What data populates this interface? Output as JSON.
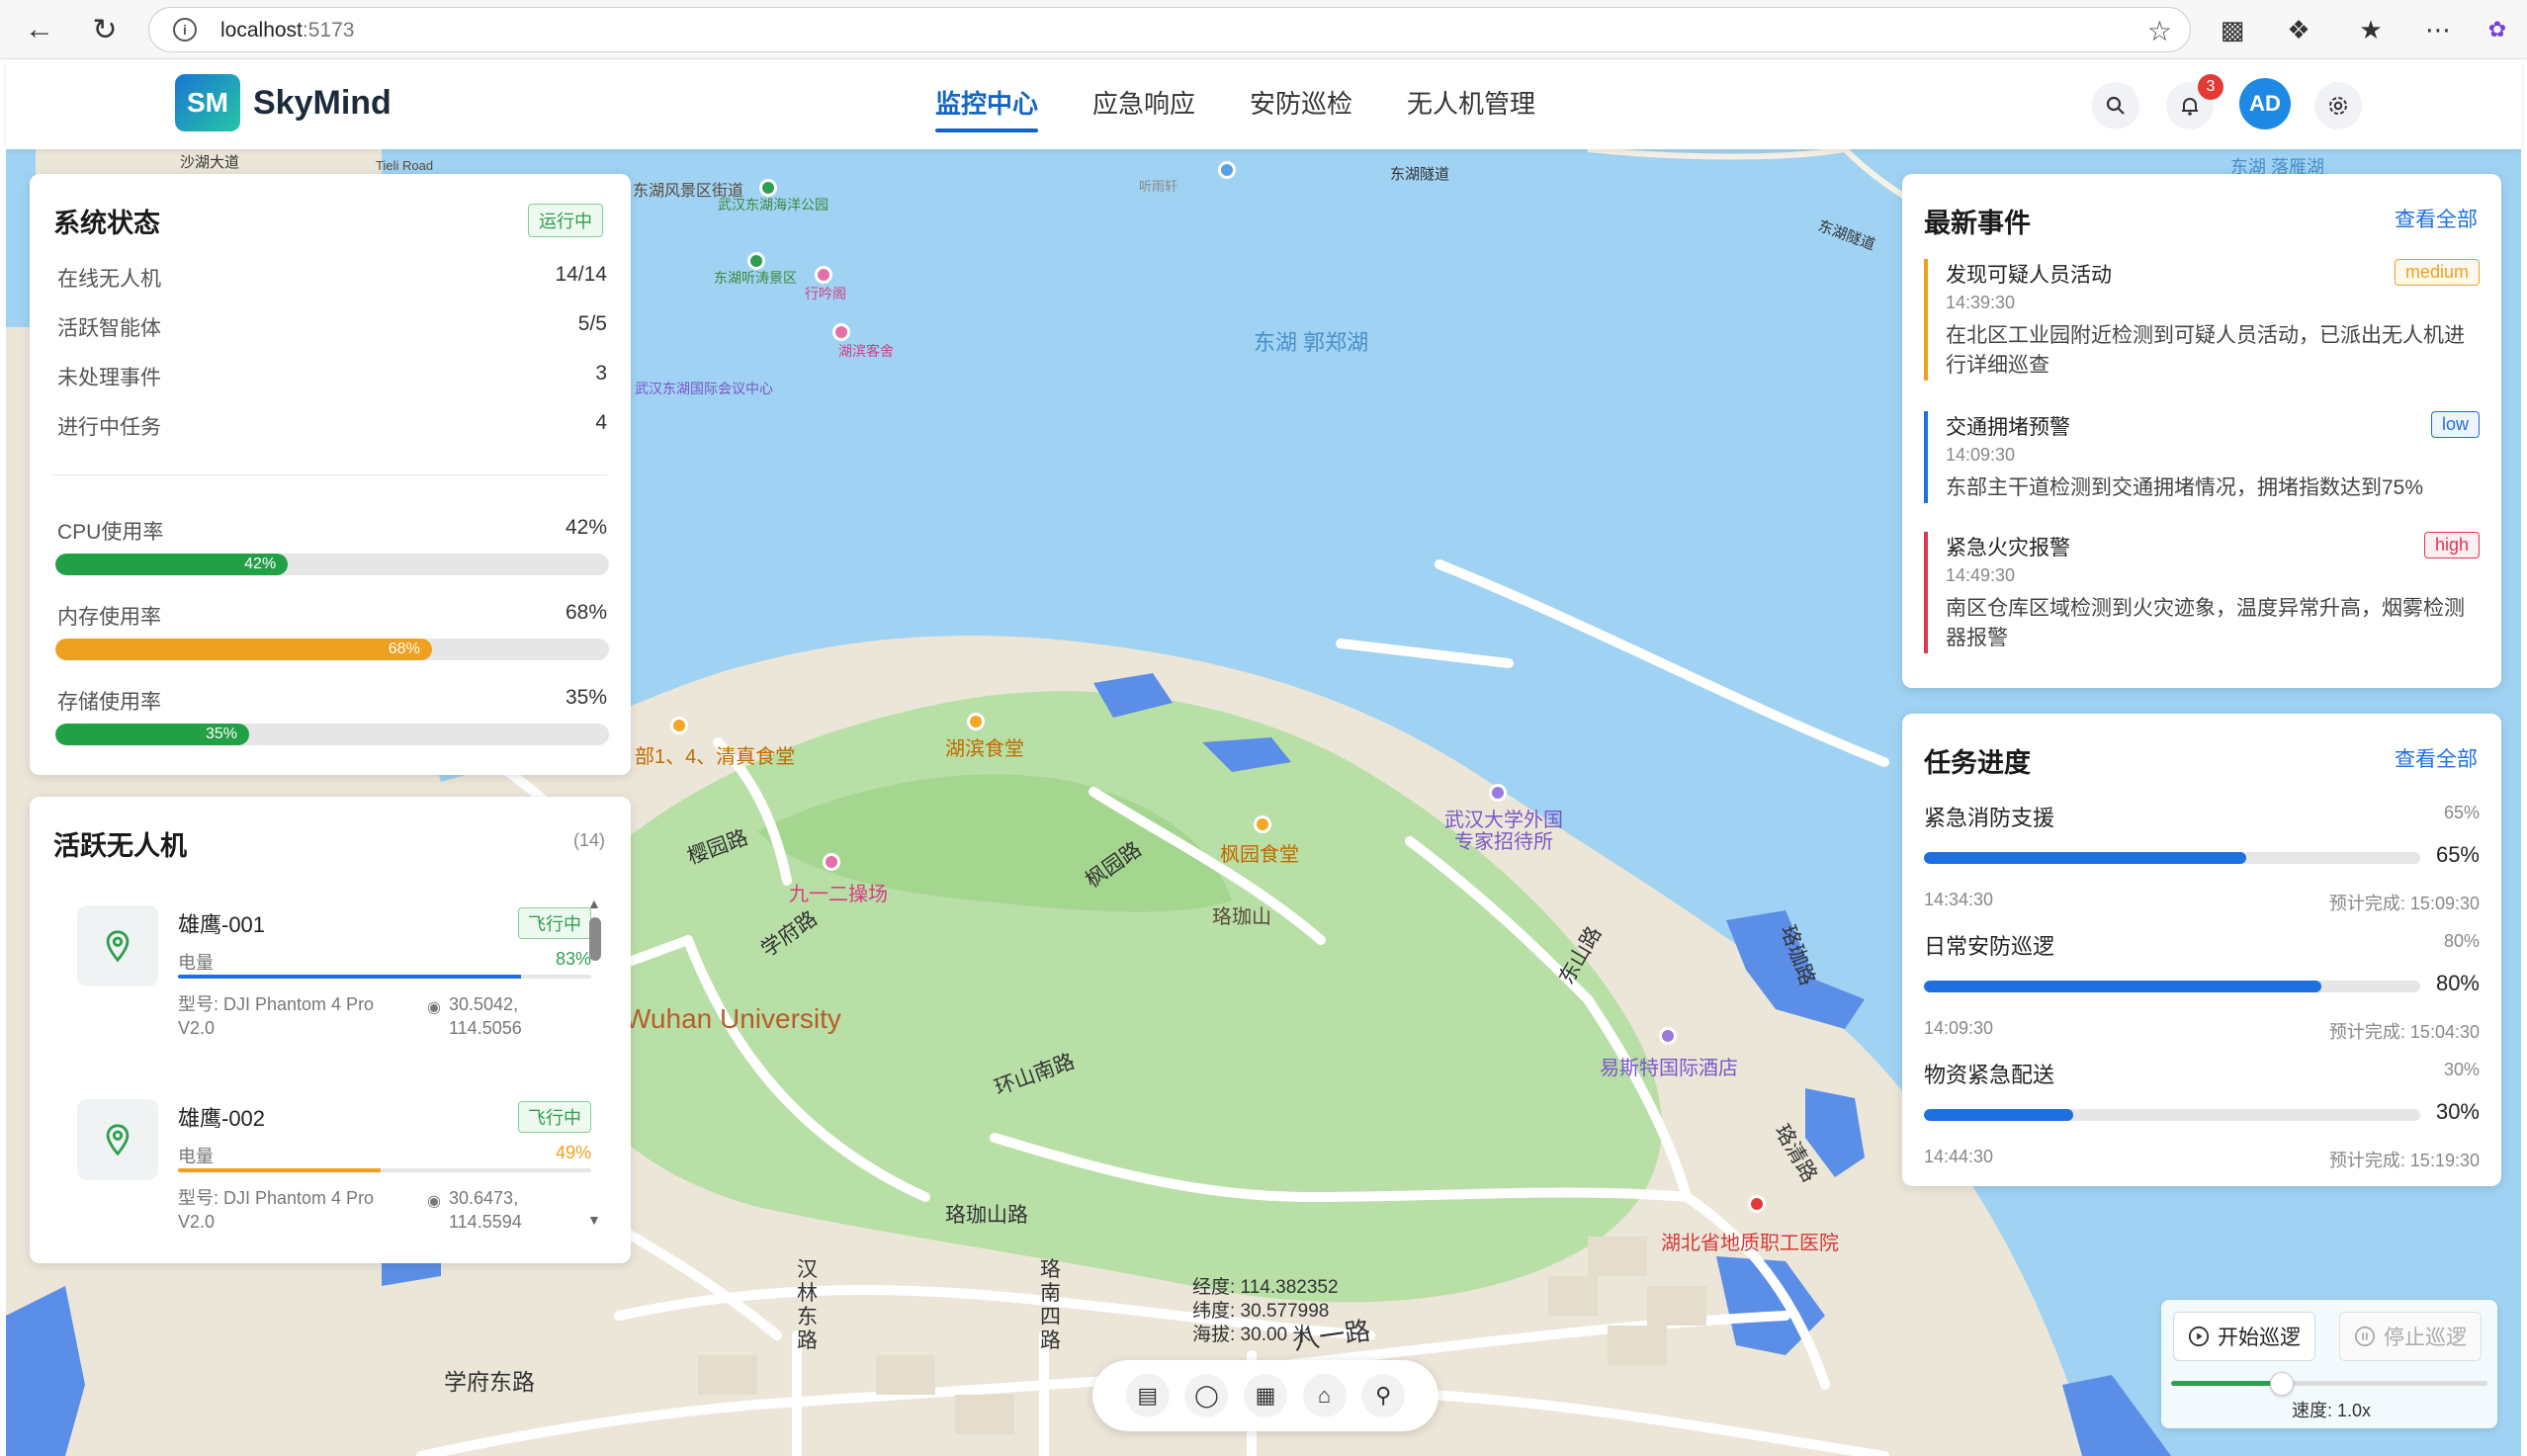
{
  "browser": {
    "url_host": "localhost",
    "url_port": ":5173"
  },
  "app": {
    "logo_badge": "SM",
    "logo_text": "SkyMind",
    "nav": [
      "监控中心",
      "应急响应",
      "安防巡检",
      "无人机管理"
    ],
    "active_nav": "监控中心",
    "notification_count": "3",
    "avatar_initials": "AD"
  },
  "system_status": {
    "title": "系统状态",
    "status_tag": "运行中",
    "rows": [
      {
        "label": "在线无人机",
        "value": "14/14"
      },
      {
        "label": "活跃智能体",
        "value": "5/5"
      },
      {
        "label": "未处理事件",
        "value": "3"
      },
      {
        "label": "进行中任务",
        "value": "4"
      }
    ],
    "resources": [
      {
        "label": "CPU使用率",
        "value": "42%",
        "bar_text": "42%",
        "fraction": 0.42,
        "color": "#22a045"
      },
      {
        "label": "内存使用率",
        "value": "68%",
        "bar_text": "68%",
        "fraction": 0.68,
        "color": "#f0a020"
      },
      {
        "label": "存储使用率",
        "value": "35%",
        "bar_text": "35%",
        "fraction": 0.35,
        "color": "#22a045"
      }
    ]
  },
  "drones": {
    "title": "活跃无人机",
    "count": "(14)",
    "items": [
      {
        "name": "雄鹰-001",
        "status": "飞行中",
        "battery_label": "电量",
        "battery": "83%",
        "battery_fraction": 0.83,
        "battery_color": "#1e6fe0",
        "battery_text_color": "#2e9e4f",
        "model": "型号: DJI Phantom 4 Pro V2.0",
        "coords": "30.5042, 114.5056"
      },
      {
        "name": "雄鹰-002",
        "status": "飞行中",
        "battery_label": "电量",
        "battery": "49%",
        "battery_fraction": 0.49,
        "battery_color": "#f0a020",
        "battery_text_color": "#f0a020",
        "model": "型号: DJI Phantom 4 Pro V2.0",
        "coords": "30.6473, 114.5594"
      }
    ]
  },
  "events": {
    "title": "最新事件",
    "view_all": "查看全部",
    "items": [
      {
        "title": "发现可疑人员活动",
        "time": "14:39:30",
        "level": "medium",
        "color": "#f0a020",
        "desc": "在北区工业园附近检测到可疑人员活动，已派出无人机进行详细巡查"
      },
      {
        "title": "交通拥堵预警",
        "time": "14:09:30",
        "level": "low",
        "color": "#1e6fe0",
        "desc": "东部主干道检测到交通拥堵情况，拥堵指数达到75%"
      },
      {
        "title": "紧急火灾报警",
        "time": "14:49:30",
        "level": "high",
        "color": "#e0344f",
        "desc": "南区仓库区域检测到火灾迹象，温度异常升高，烟雾检测器报警"
      }
    ]
  },
  "tasks": {
    "title": "任务进度",
    "view_all": "查看全部",
    "items": [
      {
        "name": "紧急消防支援",
        "pct": "65%",
        "fraction": 0.65,
        "start": "14:34:30",
        "eta": "预计完成: 15:09:30"
      },
      {
        "name": "日常安防巡逻",
        "pct": "80%",
        "fraction": 0.8,
        "start": "14:09:30",
        "eta": "预计完成: 15:04:30"
      },
      {
        "name": "物资紧急配送",
        "pct": "30%",
        "fraction": 0.3,
        "start": "14:44:30",
        "eta": "预计完成: 15:19:30"
      }
    ]
  },
  "map_readout": {
    "lng": "经度: 114.382352",
    "lat": "纬度: 30.577998",
    "alt": "海拔: 30.00 米"
  },
  "patrol": {
    "start_label": "开始巡逻",
    "stop_label": "停止巡逻",
    "speed_label": "速度: 1.0x",
    "speed_fraction": 0.35
  },
  "map_labels": {
    "lake": "东湖 郭郑湖",
    "university": "Wuhan University",
    "east_lake_scenic": "东湖风景区街道",
    "ocean_park": "武汉东湖海洋公园",
    "tingtao": "东湖听涛景区",
    "xingyin": "行吟阁",
    "conference": "武汉东湖国际会议中心",
    "binhu": "湖滨客舍",
    "donghu_tunnel": "东湖隧道",
    "donghu_tunnel2": "东湖隧道",
    "canteen_lake": "湖滨食堂",
    "canteen_qingzhen": "部1、4、清真食堂",
    "canteen_fengyuan": "枫园食堂",
    "luojia_mountain": "珞珈山",
    "playground": "九一二操场",
    "foreign_expert": "武汉大学外国专家招待所",
    "ibis": "易斯特国际酒店",
    "hospital": "湖北省地质职工医院",
    "road_yingyuan": "樱园路",
    "road_xuefu": "学府路",
    "road_fengyuan": "枫园路",
    "road_huanshannan": "环山南路",
    "road_luojiashan": "珞珈山路",
    "road_hanlin": "汉林东路",
    "road_luonan4": "珞南四路",
    "road_bayi": "八一路",
    "road_xuefudong": "学府东路",
    "road_luoqing": "珞清路",
    "road_luohuai": "珞珈路",
    "road_dongshan": "东山路",
    "tingyuan": "听雨轩",
    "tingsong": "东湖 落雁湖",
    "tieli": "Tieli Road",
    "road_top_left": "沙湖大道"
  }
}
